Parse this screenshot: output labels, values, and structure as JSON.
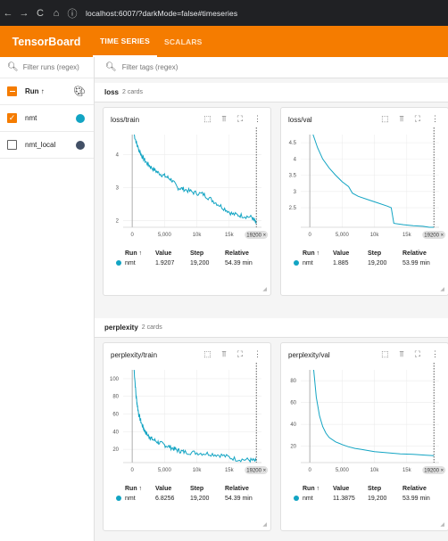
{
  "browser": {
    "url": "localhost:6007/?darkMode=false#timeseries",
    "nav": [
      "←",
      "→",
      "C",
      "⌂",
      "ⓘ"
    ]
  },
  "header": {
    "logo": "TensorBoard",
    "tabs": [
      {
        "label": "TIME SERIES",
        "active": true
      },
      {
        "label": "SCALARS",
        "active": false
      }
    ],
    "accent": "#f57c00"
  },
  "sidebar": {
    "filter_placeholder": "Filter runs (regex)",
    "run_header": "Run ↑",
    "runs": [
      {
        "name": "nmt",
        "checked": true,
        "color": "#12a4c3"
      },
      {
        "name": "nmt_local",
        "checked": false,
        "color": "#425066"
      }
    ]
  },
  "main": {
    "filter_placeholder": "Filter tags (regex)",
    "groups": [
      {
        "name": "loss",
        "count": "2 cards"
      },
      {
        "name": "perplexity",
        "count": "2 cards"
      }
    ],
    "table_headers": [
      "Run ↑",
      "Value",
      "Step",
      "Relative"
    ],
    "step_tag": "19200 ×",
    "cards": [
      {
        "title": "loss/train",
        "run": "nmt",
        "value": "1.9207",
        "step": "19,200",
        "relative": "54.39 min"
      },
      {
        "title": "loss/val",
        "run": "nmt",
        "value": "1.885",
        "step": "19,200",
        "relative": "53.99 min"
      },
      {
        "title": "perplexity/train",
        "run": "nmt",
        "value": "6.8256",
        "step": "19,200",
        "relative": "54.39 min"
      },
      {
        "title": "perplexity/val",
        "run": "nmt",
        "value": "11.3875",
        "step": "19,200",
        "relative": "53.99 min"
      }
    ]
  },
  "chart_data": [
    {
      "type": "line",
      "title": "loss/train",
      "x_ticks": [
        "0",
        "5,000",
        "10k",
        "15k"
      ],
      "y_ticks": [
        "2",
        "3",
        "4"
      ],
      "xlim": [
        -1400,
        20000
      ],
      "ylim": [
        1.8,
        4.6
      ],
      "series": [
        {
          "name": "nmt",
          "color": "#12a4c3",
          "noisy": true,
          "x": [
            300,
            800,
            1500,
            2200,
            3000,
            4000,
            5000,
            6000,
            7000,
            8000,
            9500,
            11000,
            12500,
            14000,
            15500,
            17000,
            18500,
            19200
          ],
          "y": [
            4.6,
            4.25,
            3.95,
            3.75,
            3.6,
            3.45,
            3.35,
            3.25,
            3.0,
            2.95,
            2.85,
            2.8,
            2.6,
            2.4,
            2.2,
            2.15,
            2.1,
            1.92
          ]
        }
      ]
    },
    {
      "type": "line",
      "title": "loss/val",
      "x_ticks": [
        "0",
        "5,000",
        "10k",
        "15k"
      ],
      "y_ticks": [
        "2.5",
        "3",
        "3.5",
        "4",
        "4.5"
      ],
      "xlim": [
        -1400,
        20000
      ],
      "ylim": [
        1.9,
        4.75
      ],
      "series": [
        {
          "name": "nmt",
          "color": "#12a4c3",
          "noisy": false,
          "x": [
            500,
            1200,
            2000,
            3000,
            4000,
            5000,
            6000,
            6600,
            7500,
            9000,
            10500,
            12000,
            12600,
            13000,
            14500,
            16000,
            17500,
            18500,
            19200
          ],
          "y": [
            4.75,
            4.35,
            4.0,
            3.72,
            3.5,
            3.3,
            3.15,
            2.95,
            2.85,
            2.75,
            2.65,
            2.55,
            2.5,
            2.02,
            1.98,
            1.95,
            1.93,
            1.9,
            1.885
          ]
        }
      ]
    },
    {
      "type": "line",
      "title": "perplexity/train",
      "x_ticks": [
        "0",
        "5,000",
        "10k",
        "15k"
      ],
      "y_ticks": [
        "20",
        "40",
        "60",
        "80",
        "100"
      ],
      "xlim": [
        -1400,
        20000
      ],
      "ylim": [
        5,
        110
      ],
      "series": [
        {
          "name": "nmt",
          "color": "#12a4c3",
          "noisy": true,
          "x": [
            300,
            600,
            1000,
            1500,
            2000,
            2500,
            3000,
            4000,
            5000,
            6000,
            7000,
            8000,
            10000,
            12000,
            14000,
            16000,
            18000,
            19200
          ],
          "y": [
            110,
            80,
            60,
            48,
            40,
            35,
            32,
            28,
            25,
            22,
            19,
            17,
            16,
            15,
            13,
            9,
            8,
            6.8
          ]
        }
      ]
    },
    {
      "type": "line",
      "title": "perplexity/val",
      "x_ticks": [
        "0",
        "5,000",
        "10k",
        "15k"
      ],
      "y_ticks": [
        "20",
        "40",
        "60",
        "80"
      ],
      "xlim": [
        -1400,
        20000
      ],
      "ylim": [
        5,
        90
      ],
      "series": [
        {
          "name": "nmt",
          "color": "#12a4c3",
          "noisy": false,
          "x": [
            600,
            1000,
            1500,
            2000,
            2500,
            3000,
            4000,
            5000,
            6000,
            7000,
            8000,
            9000,
            10000,
            12000,
            14000,
            16000,
            18000,
            19200
          ],
          "y": [
            90,
            65,
            48,
            38,
            32,
            28,
            24,
            21.5,
            19.5,
            18,
            17,
            16,
            15,
            14,
            13,
            12.5,
            11.8,
            11.39
          ]
        }
      ]
    }
  ]
}
